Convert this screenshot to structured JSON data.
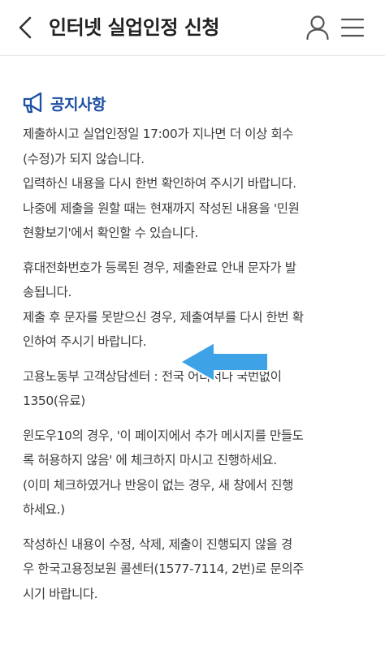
{
  "header": {
    "title": "인터넷 실업인정 신청",
    "icons": [
      "chevron-left-icon",
      "user-icon",
      "hamburger-menu-icon"
    ]
  },
  "notice": {
    "title": "공지사항",
    "icon": "megaphone-icon",
    "accent_color": "#1d4fa3"
  },
  "paragraphs": [
    {
      "lines": [
        "제출하시고 실업인정일 17:00가 지나면 더 이상 회수",
        "(수정)가 되지 않습니다.",
        "입력하신 내용을 다시 한번 확인하여 주시기 바랍니다.",
        "나중에 제출을 원할 때는 현재까지 작성된 내용을 '민원",
        "현황보기'에서 확인할 수 있습니다."
      ]
    },
    {
      "lines": [
        "휴대전화번호가 등록된 경우, 제출완료 안내 문자가 발",
        "송됩니다.",
        "제출 후 문자를 못받으신 경우, 제출여부를 다시 한번 확",
        "인하여 주시기 바랍니다."
      ]
    },
    {
      "lines": [
        "고용노동부 고객상담센터 : 전국 어디서나 국번없이",
        "1350(유료)"
      ]
    },
    {
      "lines": [
        "윈도우10의 경우, '이 페이지에서 추가 메시지를 만들도",
        "록 허용하지 않음' 에 체크하지 마시고 진행하세요.",
        "(이미 체크하였거나 반응이 없는 경우, 새 창에서 진행",
        "하세요.)"
      ]
    },
    {
      "lines": [
        "작성하신 내용이 수정, 삭제, 제출이 진행되지 않을 경",
        "우 한국고용정보원 콜센터(1577-7114, 2번)로 문의주",
        "시기 바랍니다."
      ]
    }
  ],
  "annotation": {
    "icon": "arrow-left-icon",
    "color": "#3ea3e6"
  }
}
